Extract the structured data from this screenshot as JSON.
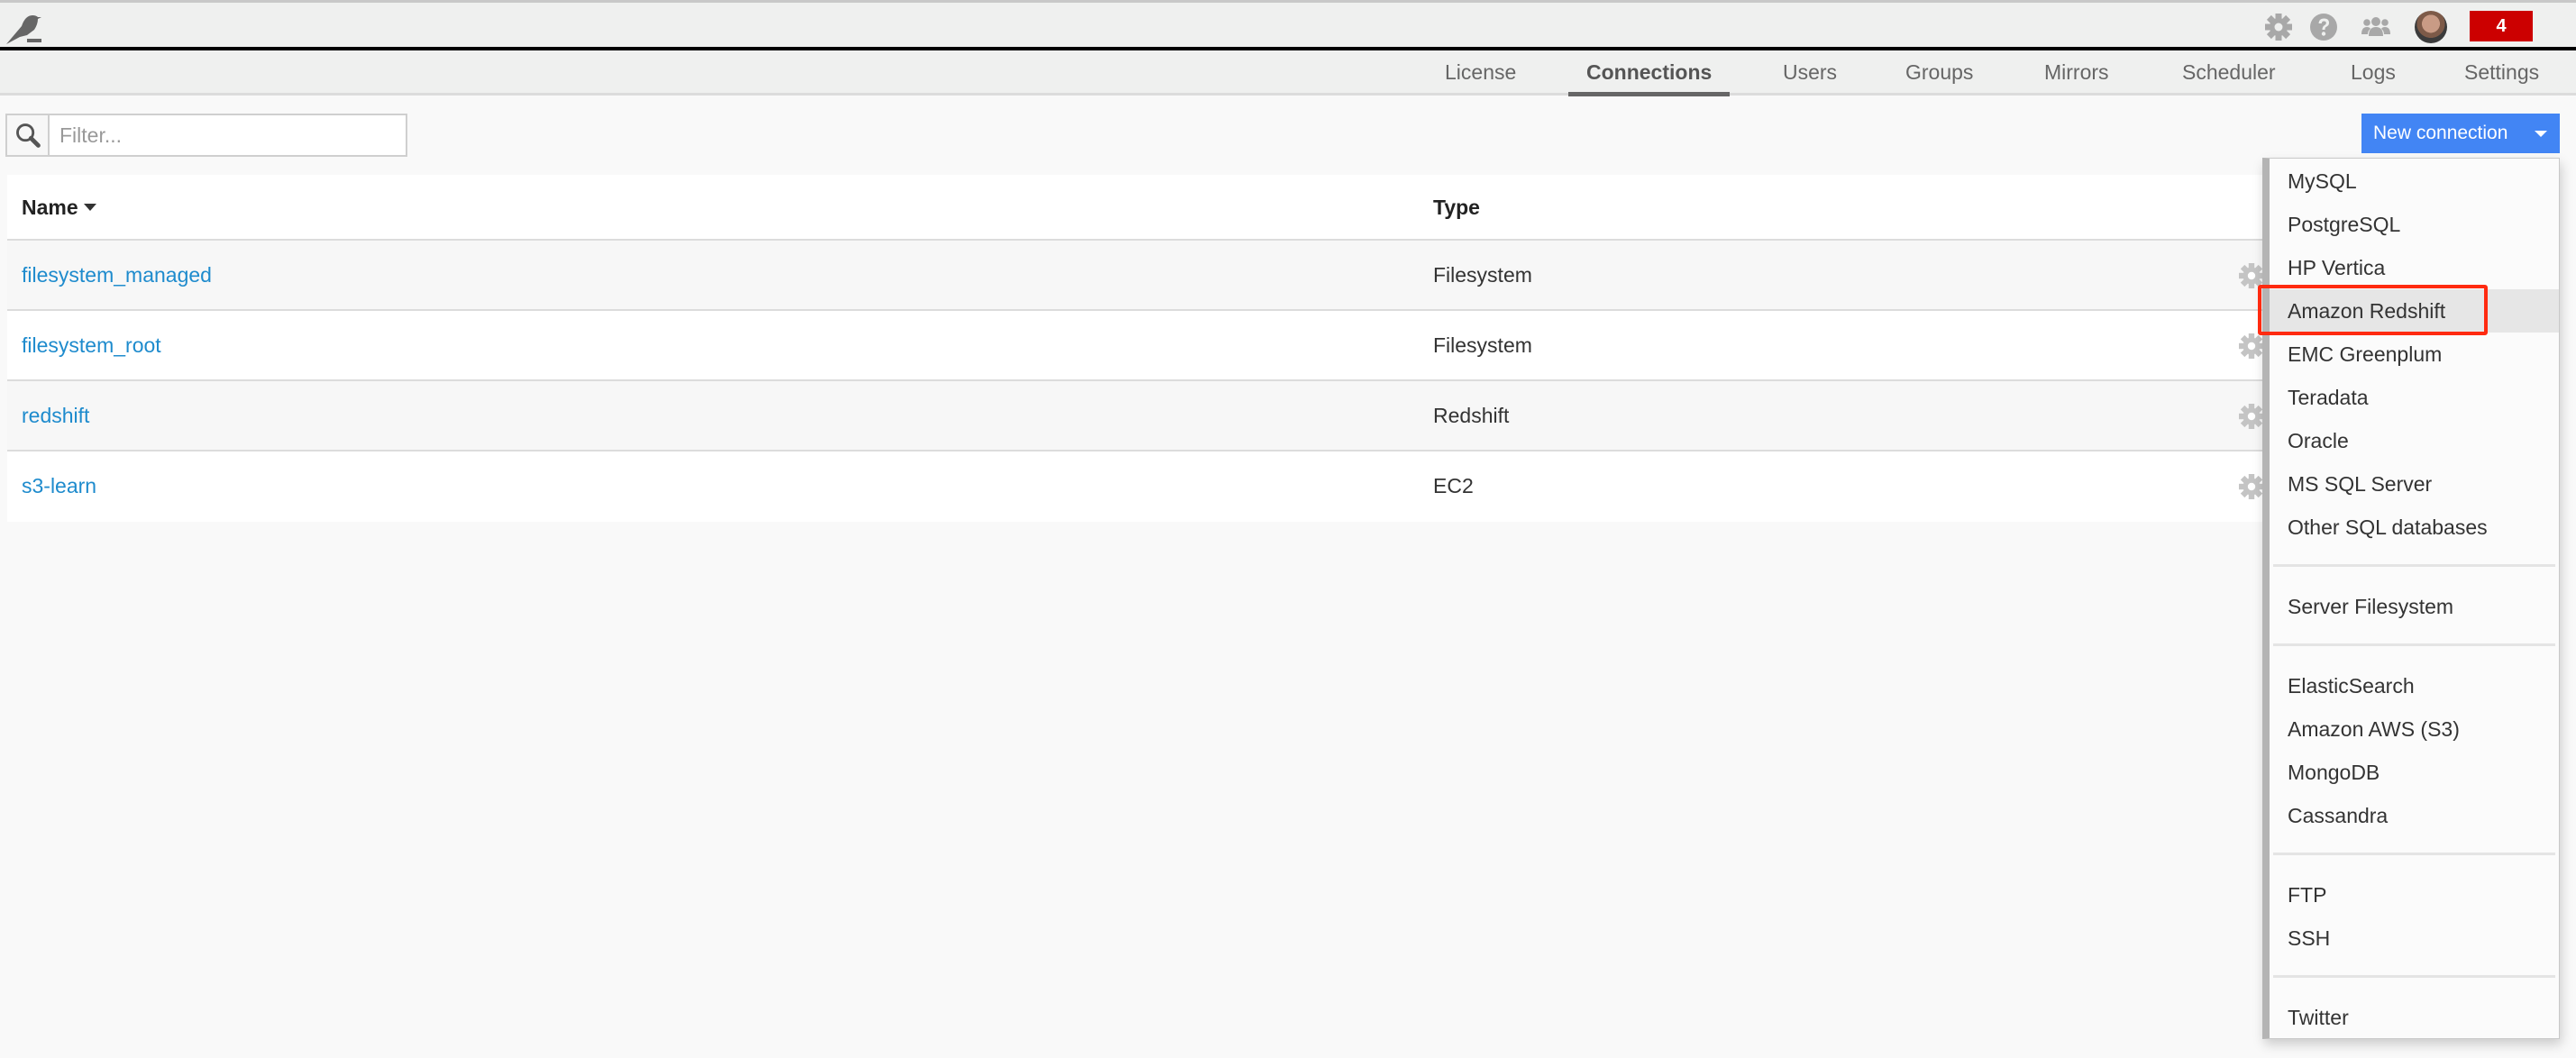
{
  "header": {
    "logo_icon": "bird-logo-icon",
    "icons": [
      "gear-icon",
      "help-icon",
      "users-icon"
    ],
    "avatar": "user-avatar",
    "notification_count": "4",
    "badge_color": "#cc0000"
  },
  "tabs": [
    {
      "label": "License",
      "active": false
    },
    {
      "label": "Connections",
      "active": true
    },
    {
      "label": "Users",
      "active": false
    },
    {
      "label": "Groups",
      "active": false
    },
    {
      "label": "Mirrors",
      "active": false
    },
    {
      "label": "Scheduler",
      "active": false
    },
    {
      "label": "Logs",
      "active": false
    },
    {
      "label": "Settings",
      "active": false
    }
  ],
  "filter": {
    "placeholder": "Filter...",
    "value": ""
  },
  "new_connection": {
    "label": "New connection",
    "color": "#4285f4"
  },
  "table": {
    "columns": {
      "name": "Name",
      "type": "Type"
    },
    "sort": {
      "column": "Name",
      "direction": "descending"
    },
    "rows": [
      {
        "name": "filesystem_managed",
        "type": "Filesystem"
      },
      {
        "name": "filesystem_root",
        "type": "Filesystem"
      },
      {
        "name": "redshift",
        "type": "Redshift"
      },
      {
        "name": "s3-learn",
        "type": "EC2"
      }
    ]
  },
  "dropdown": {
    "hovered": "Amazon Redshift",
    "highlight_color": "#ff2a10",
    "groups": [
      [
        "MySQL",
        "PostgreSQL",
        "HP Vertica",
        "Amazon Redshift",
        "EMC Greenplum",
        "Teradata",
        "Oracle",
        "MS SQL Server",
        "Other SQL databases"
      ],
      [
        "Server Filesystem"
      ],
      [
        "ElasticSearch",
        "Amazon AWS (S3)",
        "MongoDB",
        "Cassandra"
      ],
      [
        "FTP",
        "SSH"
      ],
      [
        "Twitter"
      ]
    ]
  }
}
